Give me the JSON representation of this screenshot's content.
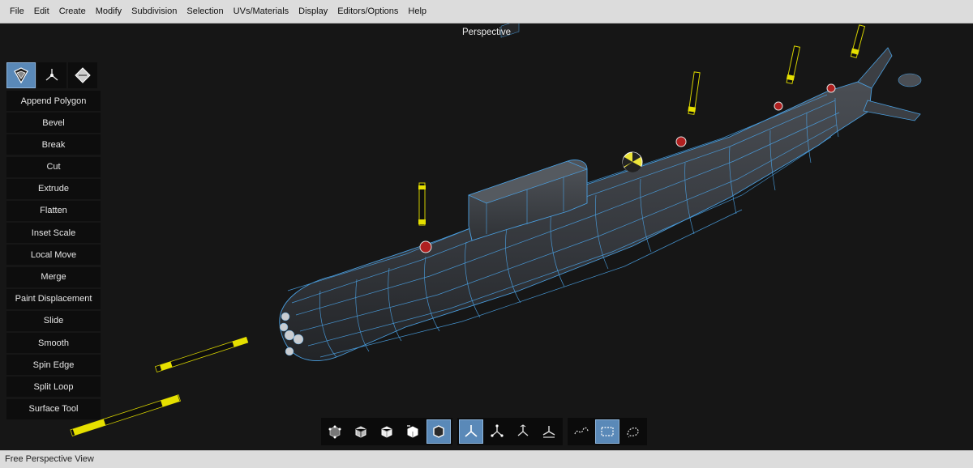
{
  "menu": [
    "File",
    "Edit",
    "Create",
    "Modify",
    "Subdivision",
    "Selection",
    "UVs/Materials",
    "Display",
    "Editors/Options",
    "Help"
  ],
  "viewport": {
    "title": "Perspective"
  },
  "modes": [
    {
      "name": "polygon-mode-icon",
      "active": true
    },
    {
      "name": "vertex-mode-icon",
      "active": false
    },
    {
      "name": "object-mode-icon",
      "active": false
    }
  ],
  "tools": [
    "Append Polygon",
    "Bevel",
    "Break",
    "Cut",
    "Extrude",
    "Flatten",
    "Inset Scale",
    "Local Move",
    "Merge",
    "Paint Displacement",
    "Slide",
    "Smooth",
    "Spin Edge",
    "Split Loop",
    "Surface Tool"
  ],
  "bottom_toolbar": {
    "selection_modes": [
      "vertices-select-icon",
      "edges-select-icon",
      "faces-select-icon",
      "uv-select-icon",
      "object-select-icon"
    ],
    "selection_active": 4,
    "transform_modes": [
      "world-axis-icon",
      "local-axis-icon",
      "screen-axis-icon",
      "normal-axis-icon"
    ],
    "transform_active": 0,
    "lasso_modes": [
      "lasso-select-icon",
      "rect-select-icon",
      "paint-select-icon"
    ],
    "lasso_active": 1
  },
  "status": {
    "text": "Free Perspective View"
  },
  "colors": {
    "accent": "#5a89b8",
    "wire": "#4a9fe0",
    "hull": "#3a3d42",
    "missile_tip": "#e6e000"
  }
}
